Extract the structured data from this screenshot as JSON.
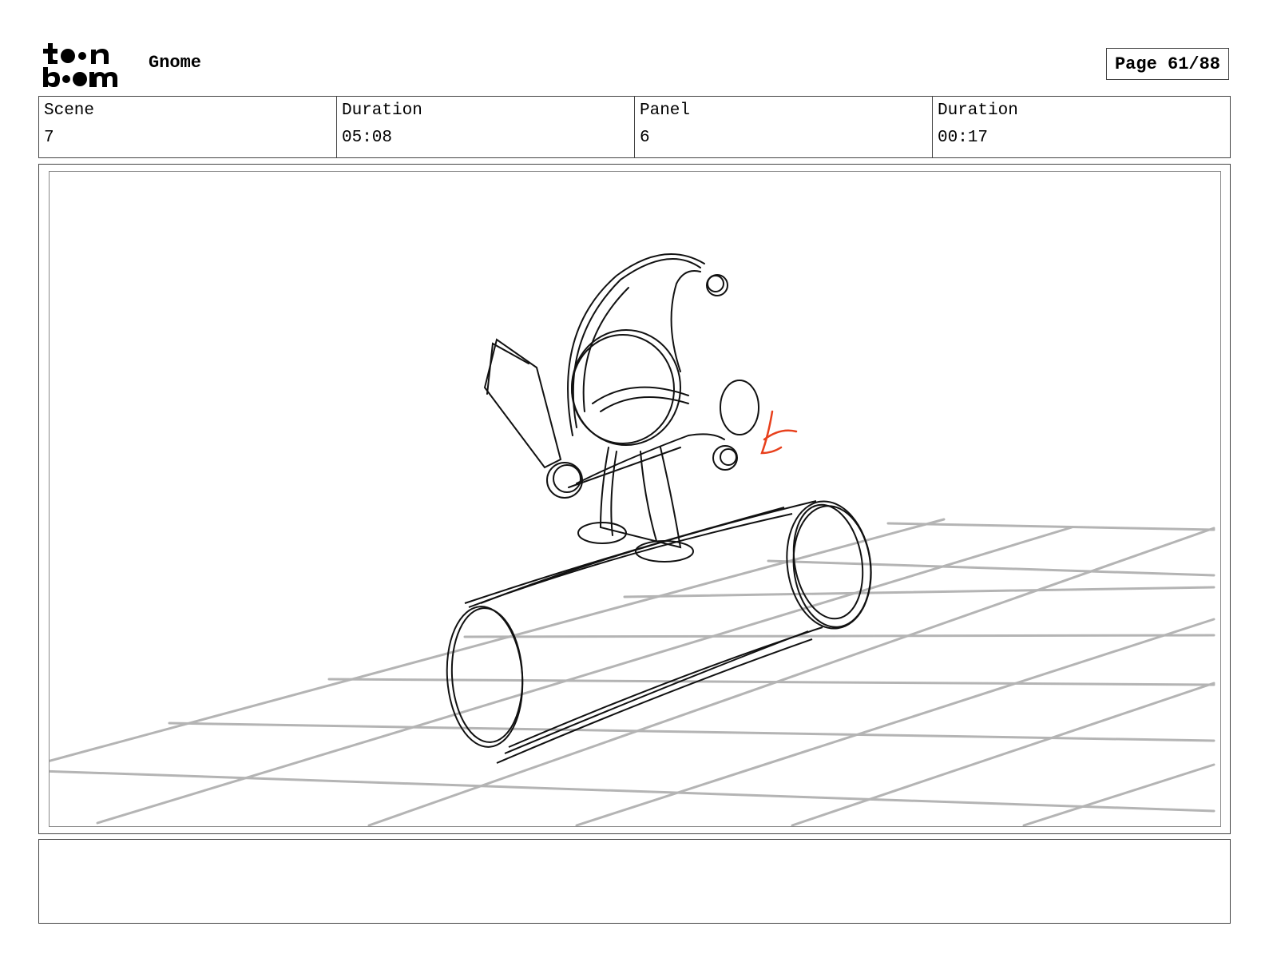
{
  "header": {
    "logo_text": "toon boom",
    "project_title": "Gnome",
    "page_label": "Page 61/88"
  },
  "info": {
    "scene_label": "Scene",
    "scene_value": "7",
    "scene_duration_label": "Duration",
    "scene_duration_value": "05:08",
    "panel_label": "Panel",
    "panel_value": "6",
    "panel_duration_label": "Duration",
    "panel_duration_value": "00:17"
  },
  "panel": {
    "sketch_description_icon": "gnome-sketch-icon",
    "accent_color": "#e8401c"
  },
  "notes": {
    "text": ""
  }
}
